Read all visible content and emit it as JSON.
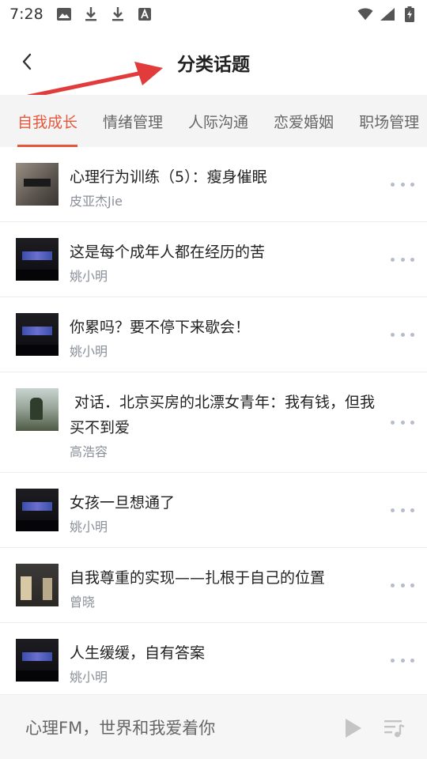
{
  "status_bar": {
    "time": "7:28",
    "left_icons": [
      "image-icon",
      "download-icon",
      "download-icon",
      "font-a-icon"
    ],
    "right_icons": [
      "wifi-icon",
      "signal-icon",
      "battery-charging-icon"
    ]
  },
  "header": {
    "title": "分类话题",
    "back_icon": "chevron-left-icon",
    "annotation_color": "#e23b3b"
  },
  "tabs": [
    {
      "label": "自我成长",
      "active": true
    },
    {
      "label": "情绪管理",
      "active": false
    },
    {
      "label": "人际沟通",
      "active": false
    },
    {
      "label": "恋爱婚姻",
      "active": false
    },
    {
      "label": "职场管理",
      "active": false
    }
  ],
  "accent_color": "#e4593d",
  "list": [
    {
      "title": "心理行为训练（5）：瘦身催眠",
      "author": "皮亚杰Jie",
      "thumb": "photo1"
    },
    {
      "title": "这是每个成年人都在经历的苦",
      "author": "姚小明",
      "thumb": "dark"
    },
    {
      "title": "你累吗？要不停下来歇会！",
      "author": "姚小明",
      "thumb": "dark"
    },
    {
      "title": " 对话．北京买房的北漂女青年：我有钱，但我买不到爱",
      "author": "高浩容",
      "thumb": "photo2"
    },
    {
      "title": "女孩一旦想通了",
      "author": "姚小明",
      "thumb": "dark"
    },
    {
      "title": "自我尊重的实现——扎根于自己的位置",
      "author": "曾晓",
      "thumb": "photo3"
    },
    {
      "title": "人生缓缓，自有答案",
      "author": "姚小明",
      "thumb": "dark"
    }
  ],
  "player": {
    "text": "心理FM，世界和我爱着你",
    "play_icon": "play-icon",
    "playlist_icon": "playlist-music-icon"
  }
}
